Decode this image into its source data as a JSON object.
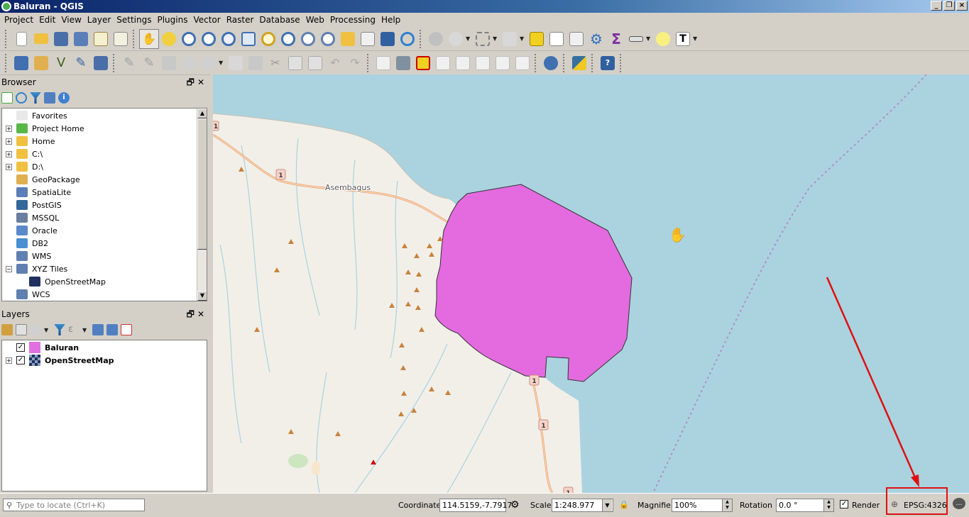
{
  "window": {
    "title": "Baluran - QGIS",
    "buttons": [
      "_",
      "❐",
      "×"
    ]
  },
  "menu": [
    "Project",
    "Edit",
    "View",
    "Layer",
    "Settings",
    "Plugins",
    "Vector",
    "Raster",
    "Database",
    "Web",
    "Processing",
    "Help"
  ],
  "browser": {
    "title": "Browser",
    "items": [
      {
        "label": "Favorites",
        "expandable": false,
        "icon": "star-icon",
        "color": "#e8e8e8",
        "indent": 0
      },
      {
        "label": "Project Home",
        "expandable": true,
        "icon": "project-home-icon",
        "color": "#58b847",
        "indent": 0
      },
      {
        "label": "Home",
        "expandable": true,
        "icon": "folder-icon",
        "color": "#f0c040",
        "indent": 0
      },
      {
        "label": "C:\\",
        "expandable": true,
        "icon": "folder-icon",
        "color": "#f0c040",
        "indent": 0
      },
      {
        "label": "D:\\",
        "expandable": true,
        "icon": "folder-icon",
        "color": "#f0c040",
        "indent": 0
      },
      {
        "label": "GeoPackage",
        "expandable": false,
        "icon": "geopackage-icon",
        "color": "#e0b050",
        "indent": 0
      },
      {
        "label": "SpatiaLite",
        "expandable": false,
        "icon": "spatialite-icon",
        "color": "#5a7fb8",
        "indent": 0
      },
      {
        "label": "PostGIS",
        "expandable": false,
        "icon": "postgis-icon",
        "color": "#336699",
        "indent": 0
      },
      {
        "label": "MSSQL",
        "expandable": false,
        "icon": "mssql-icon",
        "color": "#6a7fa0",
        "indent": 0
      },
      {
        "label": "Oracle",
        "expandable": false,
        "icon": "oracle-icon",
        "color": "#5a8ac8",
        "indent": 0
      },
      {
        "label": "DB2",
        "expandable": false,
        "icon": "db2-icon",
        "color": "#4a90d0",
        "indent": 0
      },
      {
        "label": "WMS",
        "expandable": false,
        "icon": "globe-icon",
        "color": "#6080b0",
        "indent": 0
      },
      {
        "label": "XYZ Tiles",
        "expandable": true,
        "expanded": true,
        "icon": "globe-icon",
        "color": "#6080b0",
        "indent": 0
      },
      {
        "label": "OpenStreetMap",
        "expandable": false,
        "icon": "tiles-icon",
        "color": "#203060",
        "indent": 1
      },
      {
        "label": "WCS",
        "expandable": false,
        "icon": "globe-icon",
        "color": "#6080b0",
        "indent": 0
      }
    ]
  },
  "layers": {
    "title": "Layers",
    "items": [
      {
        "label": "Baluran",
        "checked": true,
        "expandable": false,
        "swatch": "#e070e0"
      },
      {
        "label": "OpenStreetMap",
        "checked": true,
        "expandable": true,
        "swatch": "#203060"
      }
    ]
  },
  "map": {
    "place_label": "Asembagus",
    "road_shields": [
      "1",
      "1",
      "1",
      "1",
      "1"
    ],
    "polygon_fill": "#e46ae0",
    "sea_color": "#aad3df",
    "land_color": "#f2efe9"
  },
  "status": {
    "locate_placeholder": "Type to locate (Ctrl+K)",
    "coordinate_label": "Coordinate",
    "coordinate_value": "114.5159,-7.7917",
    "scale_label": "Scale",
    "scale_value": "1:248.977",
    "magnifier_label": "Magnifier",
    "magnifier_value": "100%",
    "rotation_label": "Rotation",
    "rotation_value": "0.0 °",
    "render_label": "Render",
    "render_checked": true,
    "crs": "EPSG:4326"
  },
  "annotation_color": "#e01010"
}
